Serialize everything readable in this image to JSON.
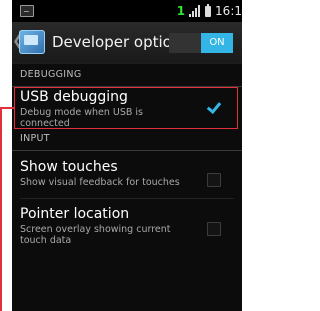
{
  "status_bar": {
    "notification_count": "1",
    "time": "16:1",
    "left_icon": "image-notification-icon",
    "signal_icon": "signal-bars-icon",
    "battery_icon": "battery-icon"
  },
  "action_bar": {
    "title": "Developer options",
    "up_icon": "chevron-left-icon",
    "app_icon": "settings-app-icon",
    "master_toggle": {
      "label": "ON",
      "state": "on"
    }
  },
  "sections": {
    "debugging": {
      "header": "DEBUGGING",
      "items": [
        {
          "title": "USB debugging",
          "summary": "Debug mode when USB is connected",
          "checked": true
        }
      ]
    },
    "input": {
      "header": "INPUT",
      "items": [
        {
          "title": "Show touches",
          "summary": "Show visual feedback for touches",
          "checked": false
        },
        {
          "title": "Pointer location",
          "summary": "Screen overlay showing current touch data",
          "checked": false
        }
      ]
    }
  },
  "colors": {
    "accent": "#33b5e5",
    "highlight": "#e0303a",
    "notification": "#2ee62e",
    "background": "#0c0c0c"
  }
}
